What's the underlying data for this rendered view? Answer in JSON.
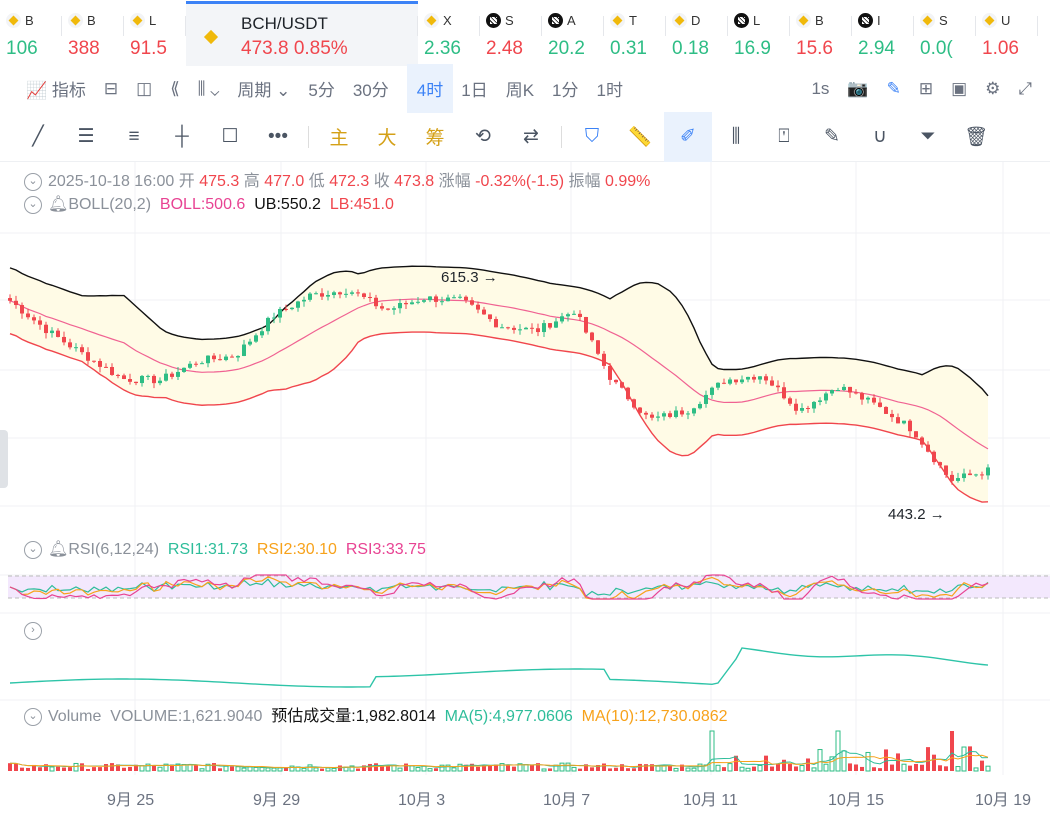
{
  "tickers": [
    {
      "sym": "B",
      "price": "106",
      "dir": "up",
      "icon": "bn"
    },
    {
      "sym": "B",
      "price": "388",
      "dir": "dn",
      "icon": "bn"
    },
    {
      "sym": "L",
      "price": "91.5",
      "dir": "dn",
      "icon": "bn"
    },
    {
      "sym": "BCH/USDT",
      "price": "473.8",
      "change": "0.85%",
      "dir": "dn",
      "icon": "bn",
      "active": true
    },
    {
      "sym": "X",
      "price": "2.36",
      "dir": "up",
      "icon": "bn"
    },
    {
      "sym": "S",
      "price": "2.48",
      "dir": "dn",
      "icon": "ok"
    },
    {
      "sym": "A",
      "price": "20.2",
      "dir": "up",
      "icon": "ok"
    },
    {
      "sym": "T",
      "price": "0.31",
      "dir": "up",
      "icon": "bn"
    },
    {
      "sym": "D",
      "price": "0.18",
      "dir": "up",
      "icon": "bn"
    },
    {
      "sym": "L",
      "price": "16.9",
      "dir": "up",
      "icon": "ok"
    },
    {
      "sym": "B",
      "price": "15.6",
      "dir": "dn",
      "icon": "bn"
    },
    {
      "sym": "I",
      "price": "2.94",
      "dir": "up",
      "icon": "ok"
    },
    {
      "sym": "S",
      "price": "0.0(",
      "dir": "up",
      "icon": "bn"
    },
    {
      "sym": "U",
      "price": "1.06",
      "dir": "dn",
      "icon": "bn"
    }
  ],
  "toolbar": {
    "indicator": "指标",
    "period": "周期",
    "intervals": [
      "5分",
      "30分",
      "4时",
      "1日",
      "周K",
      "1分",
      "1时"
    ],
    "active_interval": "4时",
    "refresh": "1s"
  },
  "drawing": {
    "zhu": "主",
    "da": "大",
    "chou": "筹"
  },
  "ohlc": {
    "time": "2025-10-18 16:00",
    "open_l": "开",
    "open": "475.3",
    "high_l": "高",
    "high": "477.0",
    "low_l": "低",
    "low": "472.3",
    "close_l": "收",
    "close": "473.8",
    "chg_l": "涨幅",
    "chg": "-0.32%(-1.5)",
    "amp_l": "振幅",
    "amp": "0.99%"
  },
  "boll": {
    "name": "BOLL(20,2)",
    "mid": "BOLL:500.6",
    "ub": "UB:550.2",
    "lb": "LB:451.0"
  },
  "rsi": {
    "name": "RSI(6,12,24)",
    "r1": "RSI1:31.73",
    "r2": "RSI2:30.10",
    "r3": "RSI3:33.75"
  },
  "volume": {
    "name": "Volume",
    "vol": "VOLUME:1,621.9040",
    "est": "预估成交量:1,982.8014",
    "ma5": "MA(5):4,977.0606",
    "ma10": "MA(10):12,730.0862"
  },
  "chart_data": {
    "type": "candlestick",
    "high_label": "615.3",
    "low_label": "443.2",
    "xticks": [
      "9月 25",
      "9月 29",
      "10月 3",
      "10月 7",
      "10月 11",
      "10月 15",
      "10月 19"
    ],
    "close_anchors": [
      598,
      576,
      558,
      541,
      540,
      554,
      558,
      587,
      602,
      606,
      591,
      600,
      598,
      580,
      576,
      591,
      540,
      511,
      518,
      540,
      544,
      518,
      536,
      522,
      504,
      467,
      474
    ],
    "colors": {
      "up": "#2ebd85",
      "down": "#f0464d",
      "ub": "#111111",
      "mid": "#f06292",
      "lb": "#f0464d"
    }
  }
}
